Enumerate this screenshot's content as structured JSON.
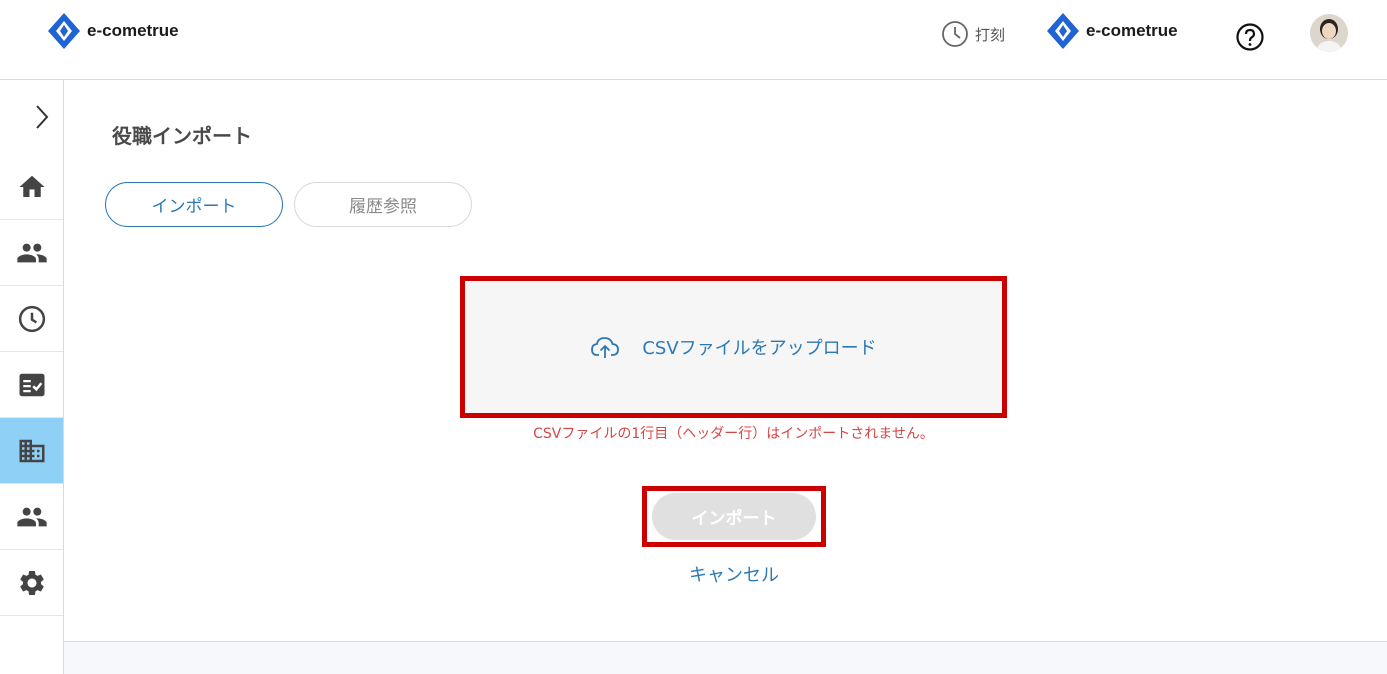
{
  "header": {
    "brand": "e-cometrue",
    "brand_right": "e-cometrue",
    "punch_label": "打刻"
  },
  "sidebar": {
    "items": [
      {
        "name": "home-icon"
      },
      {
        "name": "users-icon"
      },
      {
        "name": "clock-icon"
      },
      {
        "name": "checklist-icon"
      },
      {
        "name": "building-icon",
        "active": true
      },
      {
        "name": "group-icon"
      },
      {
        "name": "gear-icon"
      }
    ]
  },
  "page": {
    "title": "役職インポート",
    "tabs": [
      "インポート",
      "履歴参照"
    ],
    "upload_label": "CSVファイルをアップロード",
    "note": "CSVファイルの1行目（ヘッダー行）はインポートされません。",
    "import_button": "インポート",
    "cancel_link": "キャンセル"
  },
  "colors": {
    "accent": "#2b7ab5",
    "active_nav": "#8fd0f7",
    "highlight": "#cc0000",
    "error_text": "#d64545"
  }
}
